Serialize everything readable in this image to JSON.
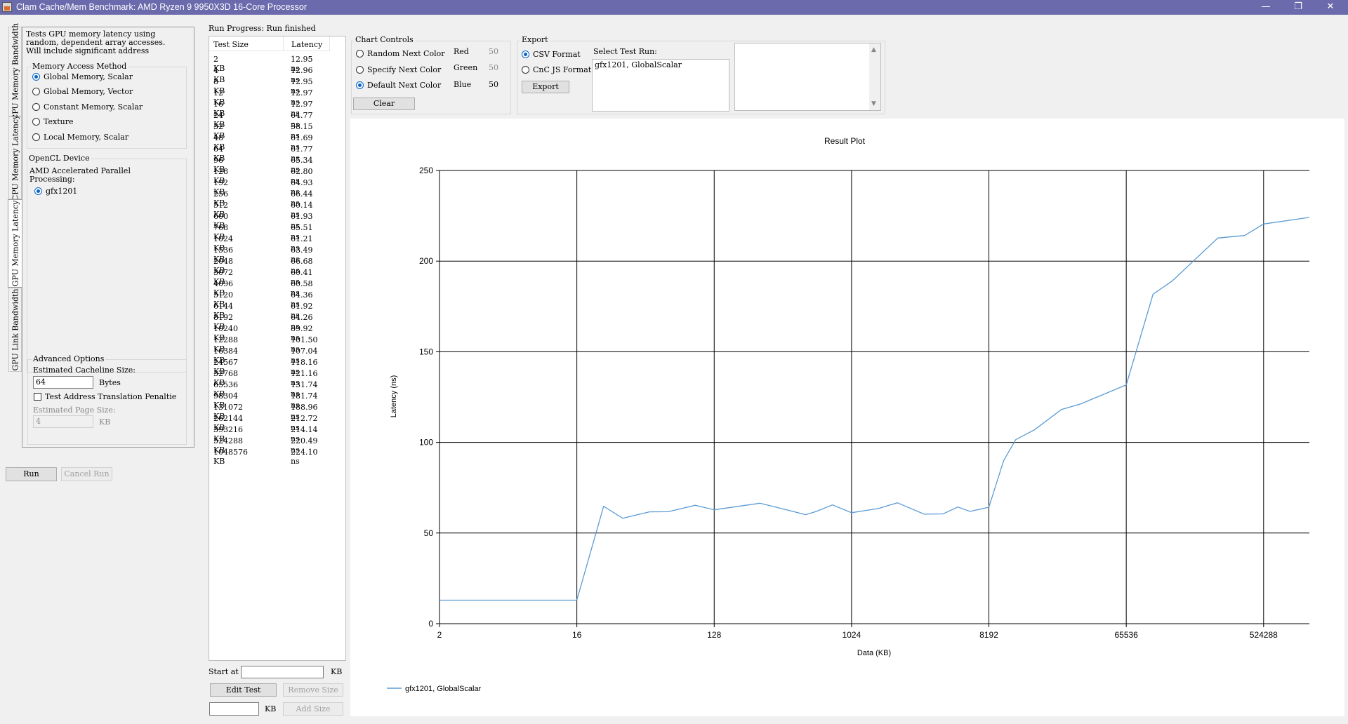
{
  "window": {
    "title": "Clam Cache/Mem Benchmark: AMD Ryzen 9 9950X3D 16-Core Processor",
    "minimize": "—",
    "maximize": "❐",
    "close": "✕"
  },
  "tabs": [
    "CPU Memory Bandwidth",
    "CPU Memory Latency",
    "GPU Memory Latency",
    "GPU Link Bandwidth"
  ],
  "description": [
    "Tests GPU memory latency using",
    "random, dependent array accesses.",
    "Will include significant address"
  ],
  "memory_access": {
    "title": "Memory Access Method",
    "options": [
      "Global Memory, Scalar",
      "Global Memory, Vector",
      "Constant Memory, Scalar",
      "Texture",
      "Local Memory, Scalar"
    ],
    "selected": "Global Memory, Scalar"
  },
  "opencl": {
    "title": "OpenCL Device",
    "platform_line1": "AMD Accelerated Parallel",
    "platform_line2": "Processing:",
    "device": "gfx1201"
  },
  "advanced": {
    "title": "Advanced Options",
    "cacheline_label": "Estimated Cacheline Size:",
    "cacheline_value": "64",
    "cacheline_unit": "Bytes",
    "tlb_label": "Test Address Translation Penaltie",
    "page_size_label": "Estimated Page Size:",
    "page_size_value": "4",
    "page_size_unit": "KB"
  },
  "run_buttons": {
    "run": "Run",
    "cancel": "Cancel Run"
  },
  "progress": "Run Progress: Run finished",
  "results": {
    "headers": [
      "Test Size",
      "Latency"
    ],
    "rows": [
      [
        "2 KB",
        "12.95 ns"
      ],
      [
        "4 KB",
        "12.96 ns"
      ],
      [
        "8 KB",
        "12.95 ns"
      ],
      [
        "12 KB",
        "12.97 ns"
      ],
      [
        "16 KB",
        "12.97 ns"
      ],
      [
        "24 KB",
        "64.77 ns"
      ],
      [
        "32 KB",
        "58.15 ns"
      ],
      [
        "48 KB",
        "61.69 ns"
      ],
      [
        "64 KB",
        "61.77 ns"
      ],
      [
        "96 KB",
        "65.34 ns"
      ],
      [
        "128 KB",
        "62.80 ns"
      ],
      [
        "192 KB",
        "64.93 ns"
      ],
      [
        "256 KB",
        "66.44 ns"
      ],
      [
        "512 KB",
        "60.14 ns"
      ],
      [
        "600 KB",
        "61.93 ns"
      ],
      [
        "768 KB",
        "65.51 ns"
      ],
      [
        "1024 KB",
        "61.21 ns"
      ],
      [
        "1536 KB",
        "63.49 ns"
      ],
      [
        "2048 KB",
        "66.68 ns"
      ],
      [
        "3072 KB",
        "60.41 ns"
      ],
      [
        "4096 KB",
        "60.58 ns"
      ],
      [
        "5120 KB",
        "64.36 ns"
      ],
      [
        "6144 KB",
        "61.92 ns"
      ],
      [
        "8192 KB",
        "64.26 ns"
      ],
      [
        "10240 KB",
        "89.92 ns"
      ],
      [
        "12288 KB",
        "101.50 ns"
      ],
      [
        "16384 KB",
        "107.04 ns"
      ],
      [
        "24567 KB",
        "118.16 ns"
      ],
      [
        "32768 KB",
        "121.16 ns"
      ],
      [
        "65536 KB",
        "131.74 ns"
      ],
      [
        "98304 KB",
        "181.74 ns"
      ],
      [
        "131072 KB",
        "188.96 ns"
      ],
      [
        "262144 KB",
        "212.72 ns"
      ],
      [
        "393216 KB",
        "214.14 ns"
      ],
      [
        "524288 KB",
        "220.49 ns"
      ],
      [
        "1048576 KB",
        "224.10 ns"
      ]
    ]
  },
  "test_edit": {
    "start_at_label": "Start at",
    "start_at_unit": "KB",
    "edit_test": "Edit Test",
    "remove_size": "Remove Size",
    "size_unit": "KB",
    "add_size": "Add Size"
  },
  "chart_controls": {
    "title": "Chart Controls",
    "options": [
      "Random Next Color",
      "Specify Next Color",
      "Default Next Color"
    ],
    "selected": "Default Next Color",
    "red_label": "Red",
    "red_value": "50",
    "green_label": "Green",
    "green_value": "50",
    "blue_label": "Blue",
    "blue_value": "50",
    "clear": "Clear"
  },
  "export": {
    "title": "Export",
    "csv": "CSV Format",
    "cnc": "CnC JS Format",
    "selected": "CSV Format",
    "export_button": "Export",
    "select_run_label": "Select Test Run:",
    "runs": [
      "gfx1201, GlobalScalar"
    ]
  },
  "colors": {
    "titlebar": "#6a6aad",
    "series": "#5b9bd5",
    "accent": "#0a64c8"
  },
  "chart_data": {
    "type": "line",
    "title": "Result Plot",
    "xlabel": "Data (KB)",
    "ylabel": "Latency (ns)",
    "x_scale": "log2",
    "xlim": [
      2,
      1048576
    ],
    "ylim": [
      0,
      250
    ],
    "x_ticks": [
      "2",
      "16",
      "128",
      "1024",
      "8192",
      "65536",
      "524288"
    ],
    "y_ticks": [
      "0",
      "50",
      "100",
      "150",
      "200",
      "250"
    ],
    "grid": true,
    "legend_position": "bottom-left",
    "series": [
      {
        "name": "gfx1201, GlobalScalar",
        "color": "#5b9bd5",
        "x": [
          2,
          4,
          8,
          12,
          16,
          24,
          32,
          48,
          64,
          96,
          128,
          192,
          256,
          512,
          600,
          768,
          1024,
          1536,
          2048,
          3072,
          4096,
          5120,
          6144,
          8192,
          10240,
          12288,
          16384,
          24567,
          32768,
          65536,
          98304,
          131072,
          262144,
          393216,
          524288,
          1048576
        ],
        "y": [
          12.95,
          12.96,
          12.95,
          12.97,
          12.97,
          64.77,
          58.15,
          61.69,
          61.77,
          65.34,
          62.8,
          64.93,
          66.44,
          60.14,
          61.93,
          65.51,
          61.21,
          63.49,
          66.68,
          60.41,
          60.58,
          64.36,
          61.92,
          64.26,
          89.92,
          101.5,
          107.04,
          118.16,
          121.16,
          131.74,
          181.74,
          188.96,
          212.72,
          214.14,
          220.49,
          224.1
        ]
      }
    ]
  }
}
